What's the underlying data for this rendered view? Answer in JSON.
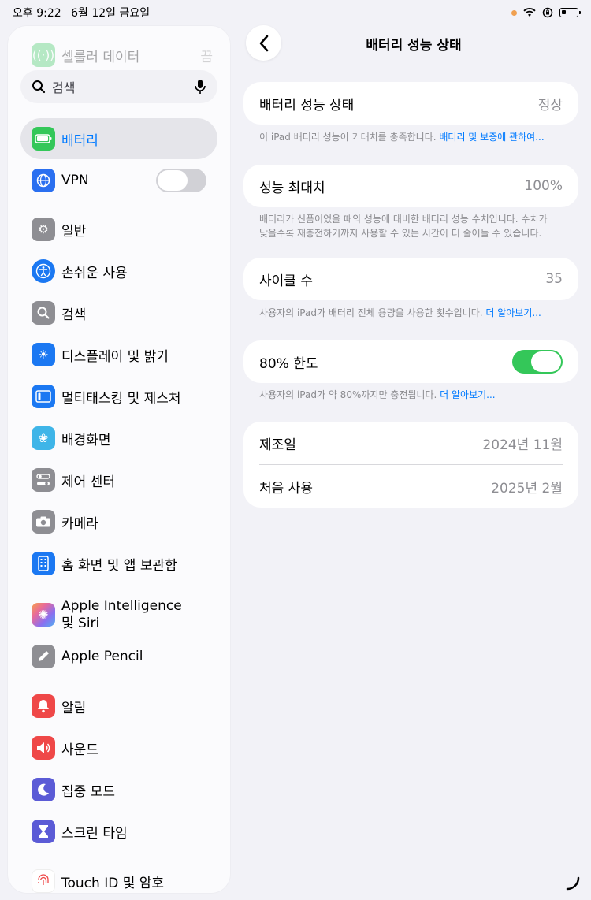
{
  "status_bar": {
    "time": "오후 9:22",
    "date": "6월 12일 금요일"
  },
  "sidebar": {
    "ghost_item": {
      "label": "셀룰러 데이터",
      "value": "끔"
    },
    "search_placeholder": "검색",
    "items": [
      {
        "label": "배터리",
        "icon": "battery-icon",
        "color": "#34c759",
        "selected": true
      },
      {
        "label": "VPN",
        "icon": "vpn-icon",
        "color": "#2a6ff0",
        "toggle": false
      },
      {
        "label": "일반",
        "icon": "gear-icon",
        "color": "#8e8e93"
      },
      {
        "label": "손쉬운 사용",
        "icon": "accessibility-icon",
        "color": "#1b78f2"
      },
      {
        "label": "검색",
        "icon": "search-icon",
        "color": "#8e8e93"
      },
      {
        "label": "디스플레이 및 밝기",
        "icon": "brightness-icon",
        "color": "#1b78f2"
      },
      {
        "label": "멀티태스킹 및 제스처",
        "icon": "multitasking-icon",
        "color": "#1b78f2"
      },
      {
        "label": "배경화면",
        "icon": "wallpaper-icon",
        "color": "#3fb5e8"
      },
      {
        "label": "제어 센터",
        "icon": "control-center-icon",
        "color": "#8e8e93"
      },
      {
        "label": "카메라",
        "icon": "camera-icon",
        "color": "#8e8e93"
      },
      {
        "label": "홈 화면 및 앱 보관함",
        "icon": "home-screen-icon",
        "color": "#1b78f2"
      },
      {
        "label_line1": "Apple Intelligence",
        "label_line2": "및 Siri",
        "icon": "siri-icon",
        "color": "#e86a9a"
      },
      {
        "label": "Apple Pencil",
        "icon": "pencil-icon",
        "color": "#8e8e93"
      },
      {
        "label": "알림",
        "icon": "bell-icon",
        "color": "#ef4848"
      },
      {
        "label": "사운드",
        "icon": "speaker-icon",
        "color": "#ef4848"
      },
      {
        "label": "집중 모드",
        "icon": "moon-icon",
        "color": "#5b5bd6"
      },
      {
        "label": "스크린 타임",
        "icon": "hourglass-icon",
        "color": "#5b5bd6"
      },
      {
        "label": "Touch ID 및 암호",
        "icon": "fingerprint-icon",
        "color": "#ef4848"
      }
    ]
  },
  "detail": {
    "title": "배터리 성능 상태",
    "health": {
      "label": "배터리 성능 상태",
      "value": "정상",
      "note": "이 iPad 배터리 성능이 기대치를 충족합니다.",
      "link": "배터리 및 보증에 관하여..."
    },
    "max_capacity": {
      "label": "성능 최대치",
      "value": "100%",
      "note_line1": "배터리가 신품이었을 때의 성능에 대비한 배터리 성능 수치입니다. 수치가",
      "note_line2": "낮을수록 재충전하기까지 사용할 수 있는 시간이 더 줄어들 수 있습니다."
    },
    "cycle": {
      "label": "사이클 수",
      "value": "35",
      "note": "사용자의 iPad가 배터리 전체 용량을 사용한 횟수입니다.",
      "link": "더 알아보기..."
    },
    "limit": {
      "label": "80% 한도",
      "toggle": true,
      "note": "사용자의 iPad가 약 80%까지만 충전됩니다.",
      "link": "더 알아보기..."
    },
    "manufactured": {
      "label": "제조일",
      "value": "2024년 11월"
    },
    "first_use": {
      "label": "처음 사용",
      "value": "2025년 2월"
    }
  }
}
